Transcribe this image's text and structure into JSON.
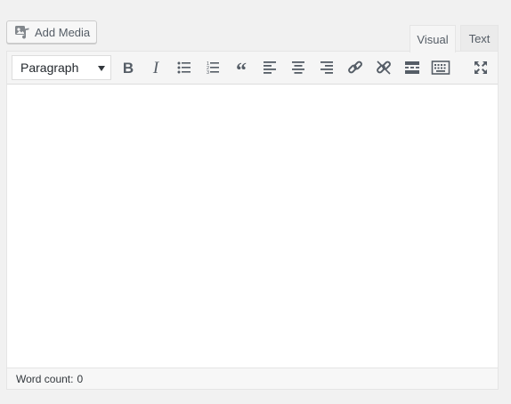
{
  "add_media": {
    "label": "Add Media",
    "icon": "add-media-icon"
  },
  "tabs": [
    {
      "label": "Visual",
      "active": true
    },
    {
      "label": "Text",
      "active": false
    }
  ],
  "toolbar": {
    "format": {
      "selected": "Paragraph"
    },
    "buttons": [
      {
        "name": "bold",
        "icon": "bold-icon"
      },
      {
        "name": "italic",
        "icon": "italic-icon"
      },
      {
        "name": "bulleted-list",
        "icon": "bulleted-list-icon"
      },
      {
        "name": "numbered-list",
        "icon": "numbered-list-icon"
      },
      {
        "name": "blockquote",
        "icon": "blockquote-icon"
      },
      {
        "name": "align-left",
        "icon": "align-left-icon"
      },
      {
        "name": "align-center",
        "icon": "align-center-icon"
      },
      {
        "name": "align-right",
        "icon": "align-right-icon"
      },
      {
        "name": "insert-link",
        "icon": "link-icon"
      },
      {
        "name": "remove-link",
        "icon": "unlink-icon"
      },
      {
        "name": "read-more",
        "icon": "read-more-icon"
      },
      {
        "name": "toolbar-toggle",
        "icon": "keyboard-icon"
      },
      {
        "name": "fullscreen",
        "icon": "fullscreen-icon"
      }
    ]
  },
  "editor": {
    "content": ""
  },
  "status": {
    "word_count_label": "Word count:",
    "word_count": "0"
  },
  "colors": {
    "background": "#f1f1f1",
    "toolbar": "#f5f5f5",
    "icon": "#555d66"
  }
}
